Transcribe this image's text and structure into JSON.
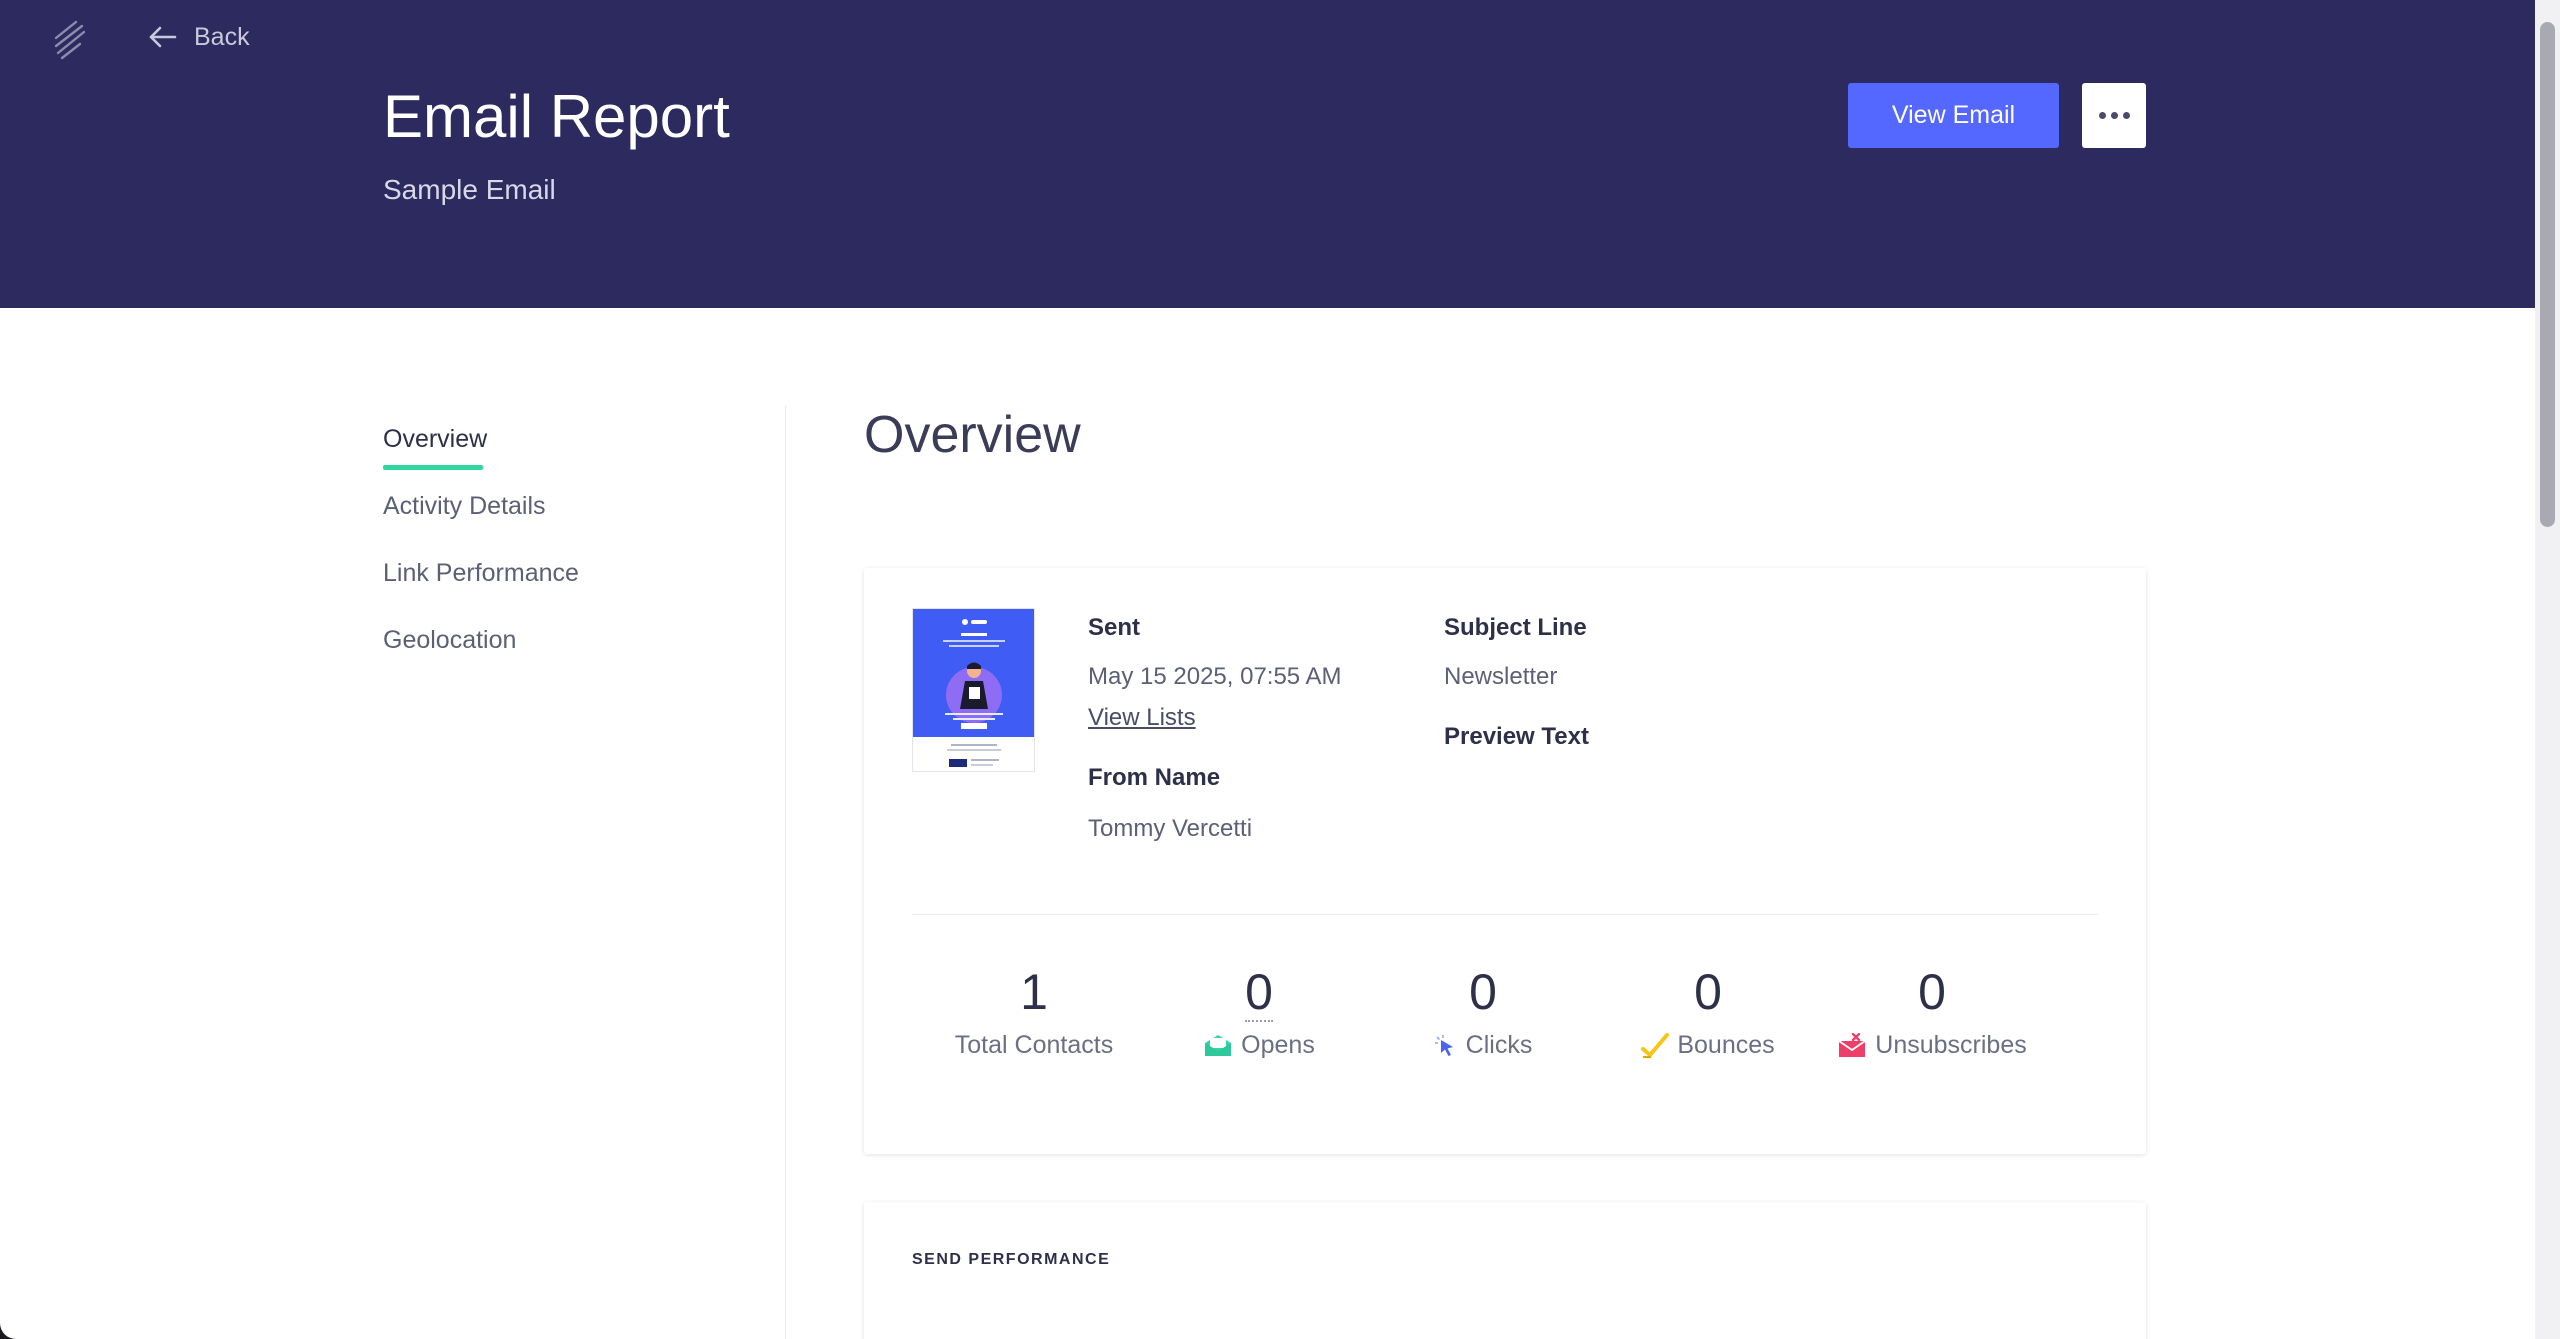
{
  "header": {
    "back_label": "Back",
    "title": "Email Report",
    "subtitle": "Sample Email",
    "view_email_label": "View Email"
  },
  "sidebar": {
    "items": [
      {
        "label": "Overview",
        "active": true
      },
      {
        "label": "Activity Details",
        "active": false
      },
      {
        "label": "Link Performance",
        "active": false
      },
      {
        "label": "Geolocation",
        "active": false
      }
    ]
  },
  "main": {
    "section_title": "Overview",
    "details": {
      "sent_label": "Sent",
      "sent_value": "May 15 2025, 07:55 AM",
      "view_lists_label": "View Lists",
      "from_name_label": "From Name",
      "from_name_value": "Tommy Vercetti",
      "subject_line_label": "Subject Line",
      "subject_line_value": "Newsletter",
      "preview_text_label": "Preview Text"
    },
    "stats": [
      {
        "value": "1",
        "label": "Total Contacts",
        "icon": ""
      },
      {
        "value": "0",
        "label": "Opens",
        "icon": "envelope-open-icon"
      },
      {
        "value": "0",
        "label": "Clicks",
        "icon": "cursor-icon"
      },
      {
        "value": "0",
        "label": "Bounces",
        "icon": "checkmark-icon"
      },
      {
        "value": "0",
        "label": "Unsubscribes",
        "icon": "envelope-x-icon"
      }
    ],
    "send_performance_heading": "SEND PERFORMANCE"
  },
  "colors": {
    "header_bg": "#2c2a5e",
    "primary_button": "#5468ff",
    "active_underline": "#2fd6a0",
    "opens_icon": "#34d5a8",
    "clicks_icon": "#4c63f0",
    "bounces_icon": "#f5c518",
    "unsubscribes_icon": "#ee3f6a"
  }
}
